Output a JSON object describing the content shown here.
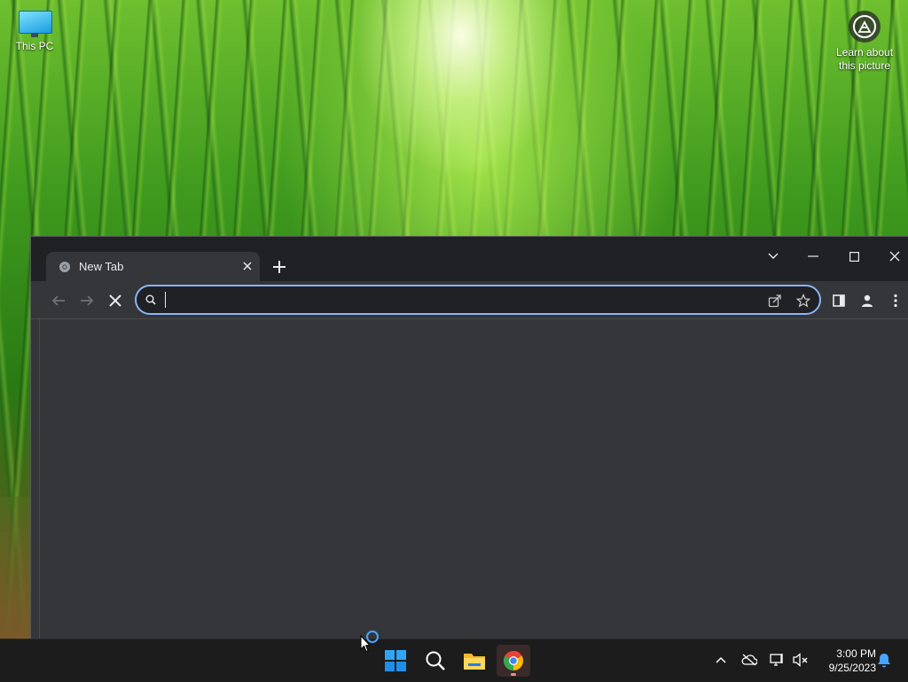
{
  "desktop": {
    "icons": [
      {
        "label": "This PC",
        "icon": "monitor-icon"
      }
    ],
    "spotlight": {
      "label_line1": "Learn about",
      "label_line2": "this picture",
      "icon": "camera-icon"
    }
  },
  "browser": {
    "tabs": [
      {
        "title": "New Tab",
        "icon": "chrome-icon",
        "active": true
      }
    ],
    "new_tab_icon": "plus-icon",
    "window_controls": [
      "tab-search-icon",
      "minimize-icon",
      "maximize-icon",
      "close-icon"
    ],
    "toolbar": {
      "back_icon": "arrow-left-icon",
      "forward_icon": "arrow-right-icon",
      "stop_icon": "x-icon",
      "address": {
        "value": "",
        "placeholder": ""
      },
      "share_icon": "share-icon",
      "bookmark_icon": "star-icon",
      "side_panel_icon": "side-panel-icon",
      "profile_icon": "person-icon",
      "menu_icon": "kebab-menu-icon"
    },
    "colors": {
      "frame": "#202124",
      "toolbar": "#35363a",
      "focus_ring": "#8ab4f8"
    }
  },
  "taskbar": {
    "apps": [
      {
        "name": "Start",
        "icon": "windows-start-icon"
      },
      {
        "name": "Search",
        "icon": "search-icon"
      },
      {
        "name": "File Explorer",
        "icon": "folder-icon"
      },
      {
        "name": "Google Chrome",
        "icon": "chrome-icon",
        "active": true
      }
    ],
    "tray": [
      "chevron-up-icon",
      "onedrive-offline-icon",
      "network-icon",
      "volume-muted-icon"
    ],
    "time": "3:00 PM",
    "date": "9/25/2023",
    "notification_icon": "bell-icon"
  }
}
